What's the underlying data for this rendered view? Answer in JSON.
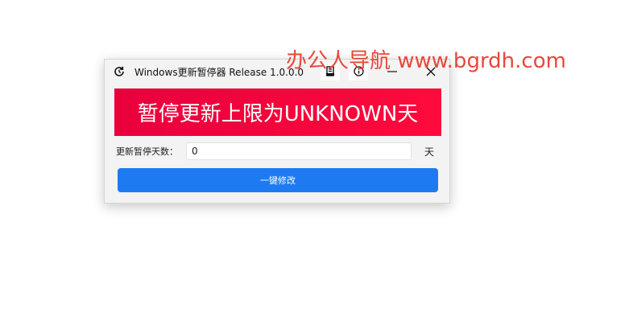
{
  "window": {
    "title": "Windows更新暂停器 Release 1.0.0.0",
    "icons": {
      "app": "refresh-icon",
      "doc": "document-icon",
      "info": "info-icon",
      "minimize": "minimize-icon",
      "close": "close-icon"
    }
  },
  "banner": {
    "text": "暂停更新上限为UNKNOWN天",
    "color": "#ff0a3c"
  },
  "form": {
    "label": "更新暂停天数：",
    "value": "0",
    "unit": "天"
  },
  "action": {
    "label": "一键修改",
    "color": "#1e7af0"
  },
  "watermark": {
    "text": "办公人导航 www.bgrdh.com",
    "color": "#e8483a"
  }
}
